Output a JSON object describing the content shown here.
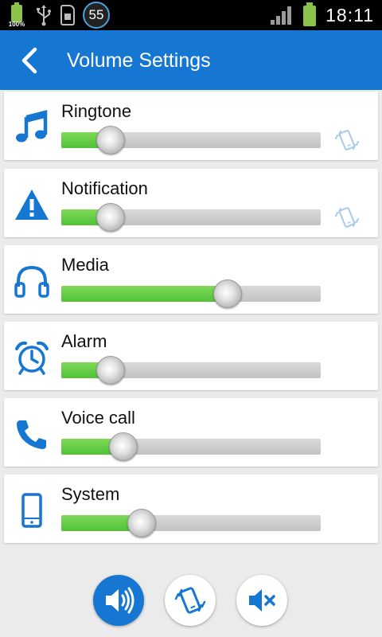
{
  "status_bar": {
    "battery_small_label": "100%",
    "notification_count": "55",
    "time": "18:11"
  },
  "app_bar": {
    "title": "Volume Settings"
  },
  "volume_items": [
    {
      "label": "Ringtone",
      "icon": "music-note-icon",
      "level": 0.19,
      "vibrate_icon": true
    },
    {
      "label": "Notification",
      "icon": "warning-icon",
      "level": 0.19,
      "vibrate_icon": true
    },
    {
      "label": "Media",
      "icon": "headphones-icon",
      "level": 0.64,
      "vibrate_icon": false
    },
    {
      "label": "Alarm",
      "icon": "alarm-clock-icon",
      "level": 0.19,
      "vibrate_icon": false
    },
    {
      "label": "Voice call",
      "icon": "phone-icon",
      "level": 0.24,
      "vibrate_icon": false
    },
    {
      "label": "System",
      "icon": "smartphone-icon",
      "level": 0.31,
      "vibrate_icon": false
    }
  ],
  "bottom_modes": [
    {
      "name": "sound-mode",
      "icon": "speaker-icon",
      "active": true
    },
    {
      "name": "vibrate-mode",
      "icon": "vibrate-phone-icon",
      "active": false
    },
    {
      "name": "mute-mode",
      "icon": "mute-icon",
      "active": false
    }
  ],
  "colors": {
    "accent": "#1677d2",
    "slider_fill": "#5ec743",
    "vibrate_icon": "#a9c9ec",
    "background": "#ebebeb"
  }
}
